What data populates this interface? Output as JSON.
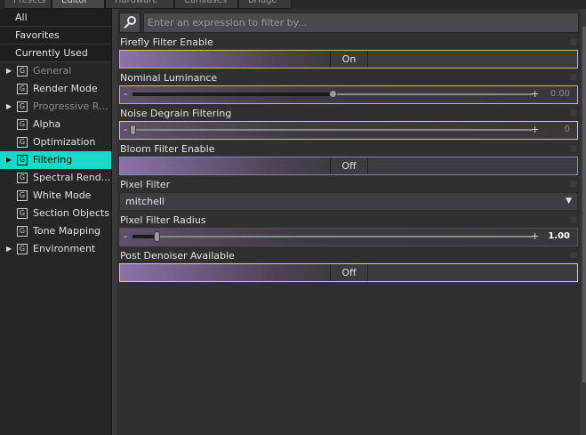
{
  "tabs": [
    {
      "label": "Presets"
    },
    {
      "label": "Editor"
    },
    {
      "label": "Hardware"
    },
    {
      "label": "Canvases"
    },
    {
      "label": "Bridge"
    }
  ],
  "sidebar": {
    "top_items": [
      {
        "label": "All"
      },
      {
        "label": "Favorites"
      },
      {
        "label": "Currently Used"
      }
    ],
    "groups": [
      {
        "label": "General",
        "expandable": true,
        "dim": true
      },
      {
        "label": "Render Mode",
        "expandable": false,
        "dim": false
      },
      {
        "label": "Progressive R...",
        "expandable": true,
        "dim": true
      },
      {
        "label": "Alpha",
        "expandable": false,
        "dim": false
      },
      {
        "label": "Optimization",
        "expandable": false,
        "dim": false
      },
      {
        "label": "Filtering",
        "expandable": true,
        "dim": false,
        "active": true
      },
      {
        "label": "Spectral Rend...",
        "expandable": false,
        "dim": false
      },
      {
        "label": "White Mode",
        "expandable": false,
        "dim": false
      },
      {
        "label": "Section Objects",
        "expandable": false,
        "dim": false
      },
      {
        "label": "Tone Mapping",
        "expandable": false,
        "dim": false
      },
      {
        "label": "Environment",
        "expandable": true,
        "dim": false
      }
    ],
    "group_icon_letter": "G",
    "active_color": "#19d9c9"
  },
  "filter": {
    "placeholder": "Enter an expression to filter by..."
  },
  "properties": {
    "firefly": {
      "label": "Firefly Filter Enable",
      "value": "On"
    },
    "nominal": {
      "label": "Nominal Luminance",
      "value": "0.00",
      "fraction": 0.5
    },
    "noise": {
      "label": "Noise Degrain Filtering",
      "value": "0",
      "fraction": 0.0
    },
    "bloom": {
      "label": "Bloom Filter Enable",
      "value": "Off"
    },
    "pixel_filter": {
      "label": "Pixel Filter",
      "value": "mitchell"
    },
    "pixel_radius": {
      "label": "Pixel Filter Radius",
      "value": "1.00",
      "fraction": 0.06
    },
    "post_denoiser": {
      "label": "Post Denoiser Available",
      "value": "Off"
    }
  },
  "glyphs": {
    "minus": "-",
    "plus": "+",
    "caret": "▼",
    "arrow": "▶"
  },
  "colors": {
    "accent": "#19d9c9",
    "border_modified": "#d9b66a",
    "border_default": "#7d8fb0",
    "border_highlight": "#e4d36a"
  }
}
